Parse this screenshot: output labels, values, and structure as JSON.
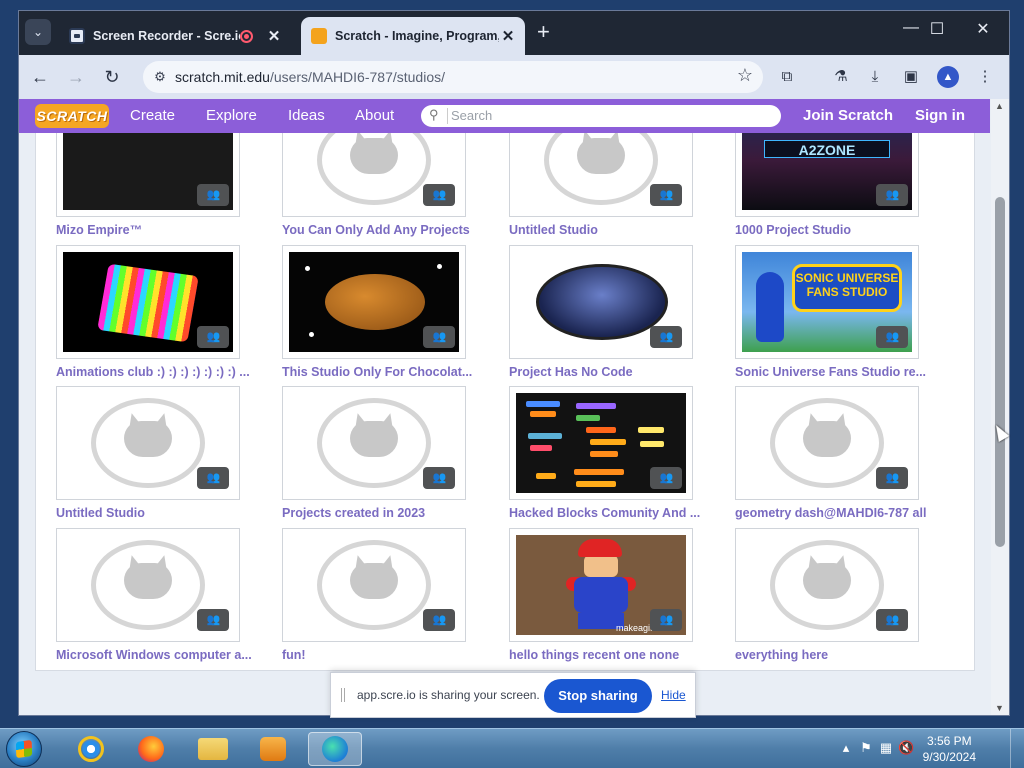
{
  "browser": {
    "tabs": [
      {
        "title": "Screen Recorder - Scre.io",
        "recording": true
      },
      {
        "title": "Scratch - Imagine, Program, Sh",
        "active": true
      }
    ],
    "url_host": "scratch.mit.edu",
    "url_path": "/users/MAHDI6-787/studios/",
    "window_controls": {
      "minimize": "—",
      "maximize": "☐",
      "close": "✕"
    }
  },
  "scratch_nav": {
    "logo": "SCRATCH",
    "links": [
      "Create",
      "Explore",
      "Ideas",
      "About"
    ],
    "search_placeholder": "Search",
    "join": "Join Scratch",
    "signin": "Sign in"
  },
  "studios": [
    {
      "title": "Mizo Empire™",
      "thumb": "mizo"
    },
    {
      "title": "You Can Only Add Any Projects",
      "thumb": "placeholder"
    },
    {
      "title": "Untitled Studio",
      "thumb": "placeholder"
    },
    {
      "title": "1000 Project Studio",
      "thumb": "a2zone"
    },
    {
      "title": "Animations club :) :) :) :) :) :) :) ...",
      "thumb": "cubes"
    },
    {
      "title": "This Studio Only For Chocolat...",
      "thumb": "chocolate"
    },
    {
      "title": "Project Has No Code",
      "thumb": "nocode"
    },
    {
      "title": "Sonic Universe Fans Studio re...",
      "thumb": "sonic"
    },
    {
      "title": "Untitled Studio",
      "thumb": "placeholder"
    },
    {
      "title": "Projects created in 2023",
      "thumb": "placeholder"
    },
    {
      "title": "Hacked Blocks Comunity And ...",
      "thumb": "blocks"
    },
    {
      "title": "geometry dash@MAHDI6-787 all",
      "thumb": "placeholder"
    },
    {
      "title": "Microsoft Windows computer a...",
      "thumb": "placeholder"
    },
    {
      "title": "fun!",
      "thumb": "placeholder"
    },
    {
      "title": "hello things recent one none",
      "thumb": "mario"
    },
    {
      "title": "everything here",
      "thumb": "placeholder"
    }
  ],
  "thumb_text": {
    "a2zone": "A2ZONE",
    "sonic_logo": "SONIC UNIVERSE FANS STUDIO",
    "mario_label": "makeagif"
  },
  "share_bar": {
    "message": "app.scre.io is sharing your screen.",
    "stop": "Stop sharing",
    "hide": "Hide"
  },
  "taskbar": {
    "time": "3:56 PM",
    "date": "9/30/2024"
  },
  "colors": {
    "scratch_purple": "#8c5ed9",
    "link_purple": "#7a6bc1",
    "stop_blue": "#1a57d1"
  }
}
